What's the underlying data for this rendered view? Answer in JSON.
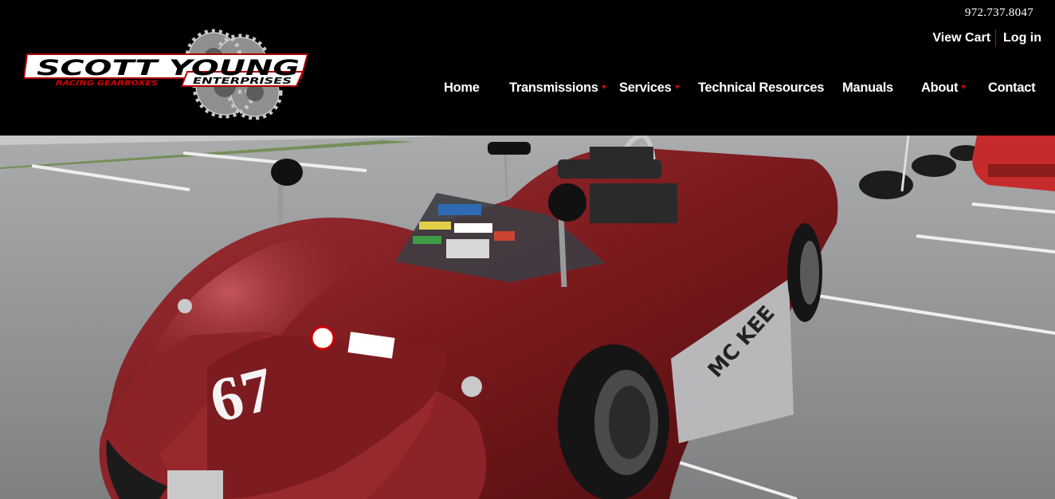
{
  "header": {
    "phone": "972.737.8047",
    "view_cart": "View Cart",
    "login": "Log in"
  },
  "logo": {
    "line1": "SCOTT YOUNG",
    "line2": "ENTERPRISES",
    "tagline": "RACING GEARBOXES"
  },
  "nav": {
    "items": [
      {
        "label": "Home",
        "dropdown": false
      },
      {
        "label": "Transmissions",
        "dropdown": true
      },
      {
        "label": "Services",
        "dropdown": true
      },
      {
        "label": "Technical Resources",
        "dropdown": false
      },
      {
        "label": "Manuals",
        "dropdown": false
      },
      {
        "label": "About",
        "dropdown": true
      },
      {
        "label": "Contact",
        "dropdown": false
      }
    ]
  },
  "hero": {
    "car_number": "67",
    "side_text": "MC KEE"
  },
  "colors": {
    "background": "#000000",
    "accent_red": "#d40000",
    "car_body": "#7a1a1d"
  }
}
